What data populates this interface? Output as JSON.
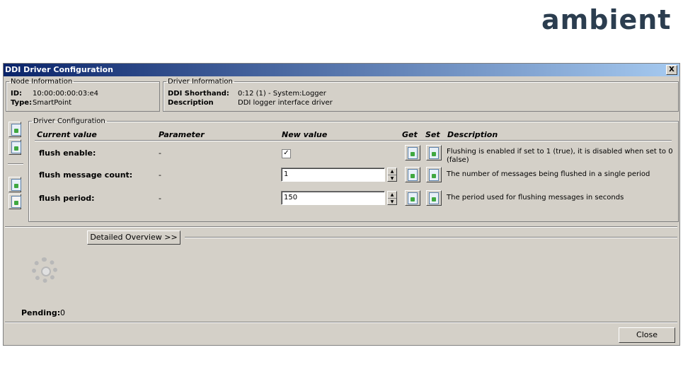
{
  "brand": {
    "logo_text": "ambient"
  },
  "window": {
    "title": "DDI Driver Configuration",
    "close_glyph": "X"
  },
  "node_info": {
    "legend": "Node Information",
    "id_label": "ID:",
    "id_value": "10:00:00:00:03:e4",
    "type_label": "Type:",
    "type_value": "SmartPoint"
  },
  "driver_info": {
    "legend": "Driver Information",
    "shorthand_label": "DDI Shorthand:",
    "shorthand_value": "0:12 (1) - System:Logger",
    "description_label": "Description",
    "description_value": "DDI logger interface driver"
  },
  "driver_config": {
    "legend": "Driver Configuration",
    "headers": {
      "current": "Current value",
      "parameter": "Parameter",
      "new": "New value",
      "get": "Get",
      "set": "Set",
      "description": "Description"
    },
    "rows": [
      {
        "label": "flush enable:",
        "parameter": "-",
        "new_value_type": "checkbox",
        "checked": true,
        "check_glyph": "✓",
        "description": "Flushing is enabled if set to 1 (true), it is disabled when set to 0 (false)"
      },
      {
        "label": "flush message count:",
        "parameter": "-",
        "new_value": "1",
        "description": "The number of messages being flushed in a single period"
      },
      {
        "label": "flush period:",
        "parameter": "-",
        "new_value": "150",
        "description": "The period used for flushing messages in seconds"
      }
    ]
  },
  "sidebar_icons": [
    "get-all-icon",
    "set-all-icon",
    "export-icon",
    "copy-icon"
  ],
  "detailed_overview": {
    "label": "Detailed Overview >>"
  },
  "status": {
    "pending_label": "Pending:",
    "pending_value": "0"
  },
  "footer": {
    "close_label": "Close"
  },
  "colors": {
    "titlebar_start": "#0a246a",
    "titlebar_end": "#a6caf0",
    "window_bg": "#d4d0c8",
    "logo": "#2b3d4f"
  }
}
